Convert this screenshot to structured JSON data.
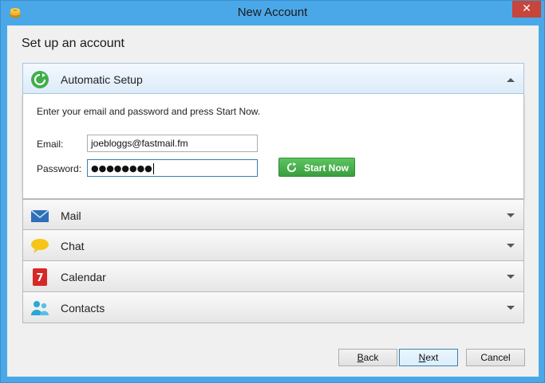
{
  "window": {
    "title": "New Account",
    "close_glyph": "✕"
  },
  "heading": "Set up an account",
  "panels": [
    {
      "label": "Automatic Setup",
      "icon": "refresh-icon",
      "expanded": true
    },
    {
      "label": "Mail",
      "icon": "envelope-icon",
      "expanded": false
    },
    {
      "label": "Chat",
      "icon": "chat-bubble-icon",
      "expanded": false
    },
    {
      "label": "Calendar",
      "icon": "calendar-icon",
      "calendar_day": "7",
      "expanded": false
    },
    {
      "label": "Contacts",
      "icon": "people-icon",
      "expanded": false
    }
  ],
  "auto_setup": {
    "instructions": "Enter your email and password and press Start Now.",
    "email_label": "Email:",
    "email_value": "joebloggs@fastmail.fm",
    "password_label": "Password:",
    "password_mask": "●●●●●●●●",
    "start_label": "Start Now"
  },
  "footer": {
    "back_underline": "B",
    "back_rest": "ack",
    "next_underline": "N",
    "next_rest": "ext",
    "cancel_label": "Cancel"
  },
  "colors": {
    "accent": "#4aa8e8",
    "start_green": "#3a9e3e",
    "close_red": "#c7453a"
  }
}
